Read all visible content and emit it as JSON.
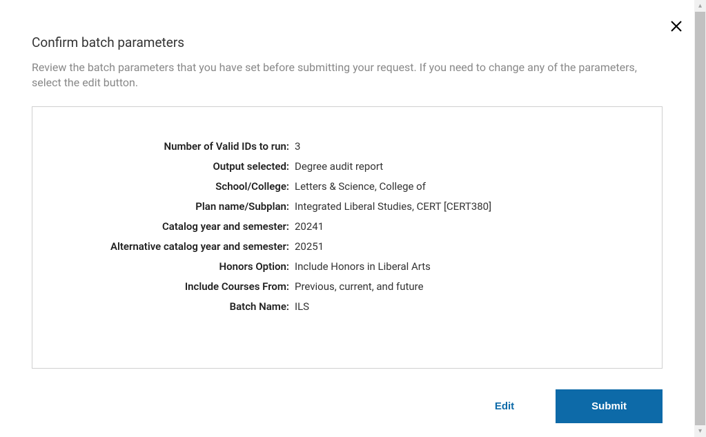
{
  "dialog": {
    "title": "Confirm batch parameters",
    "description": "Review the batch parameters that you have set before submitting your request. If you need to change any of the parameters, select the edit button."
  },
  "params": [
    {
      "label": "Number of Valid IDs to run:",
      "value": "3"
    },
    {
      "label": "Output selected:",
      "value": "Degree audit report"
    },
    {
      "label": "School/College:",
      "value": "Letters & Science, College of"
    },
    {
      "label": "Plan name/Subplan:",
      "value": "Integrated Liberal Studies, CERT [CERT380]"
    },
    {
      "label": "Catalog year and semester:",
      "value": "20241"
    },
    {
      "label": "Alternative catalog year and semester:",
      "value": "20251"
    },
    {
      "label": "Honors Option:",
      "value": "Include Honors in Liberal Arts"
    },
    {
      "label": "Include Courses From:",
      "value": "Previous, current, and future"
    },
    {
      "label": "Batch Name:",
      "value": "ILS"
    }
  ],
  "actions": {
    "edit": "Edit",
    "submit": "Submit"
  }
}
